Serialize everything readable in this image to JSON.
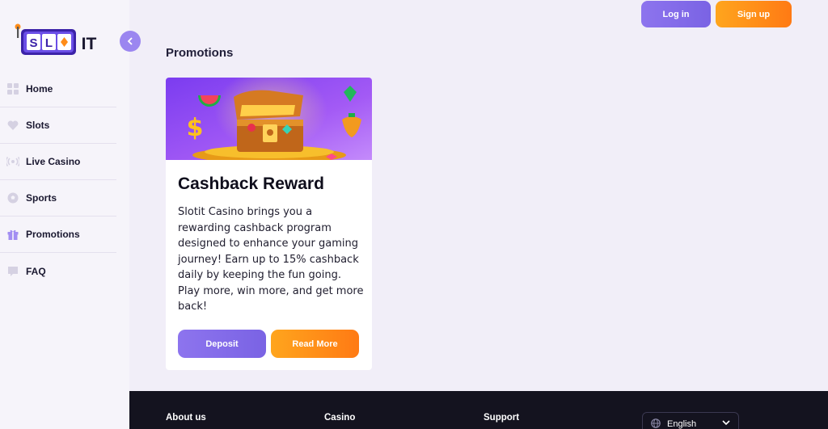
{
  "brand": {
    "logo_text": "SLOT IT",
    "accent": "#8d74ee",
    "orange": "#ff8c18"
  },
  "header": {
    "login_label": "Log in",
    "signup_label": "Sign up"
  },
  "sidebar": {
    "collapse_icon": "chevron-left-icon",
    "items": [
      {
        "label": "Home",
        "icon": "grid-icon"
      },
      {
        "label": "Slots",
        "icon": "heart-icon"
      },
      {
        "label": "Live Casino",
        "icon": "broadcast-icon"
      },
      {
        "label": "Sports",
        "icon": "ball-icon"
      },
      {
        "label": "Promotions",
        "icon": "gift-icon"
      },
      {
        "label": "FAQ",
        "icon": "faq-icon"
      }
    ]
  },
  "main": {
    "title": "Promotions",
    "card": {
      "title": "Cashback Reward",
      "description": "Slotit Casino brings you a rewarding cashback program designed to enhance your gaming journey! Earn up to 15% cashback daily by keeping the fun going. Play more, win more, and get more back!",
      "deposit_label": "Deposit",
      "read_more_label": "Read More"
    }
  },
  "footer": {
    "links": [
      "About us",
      "Casino",
      "Support"
    ],
    "language": "English"
  }
}
